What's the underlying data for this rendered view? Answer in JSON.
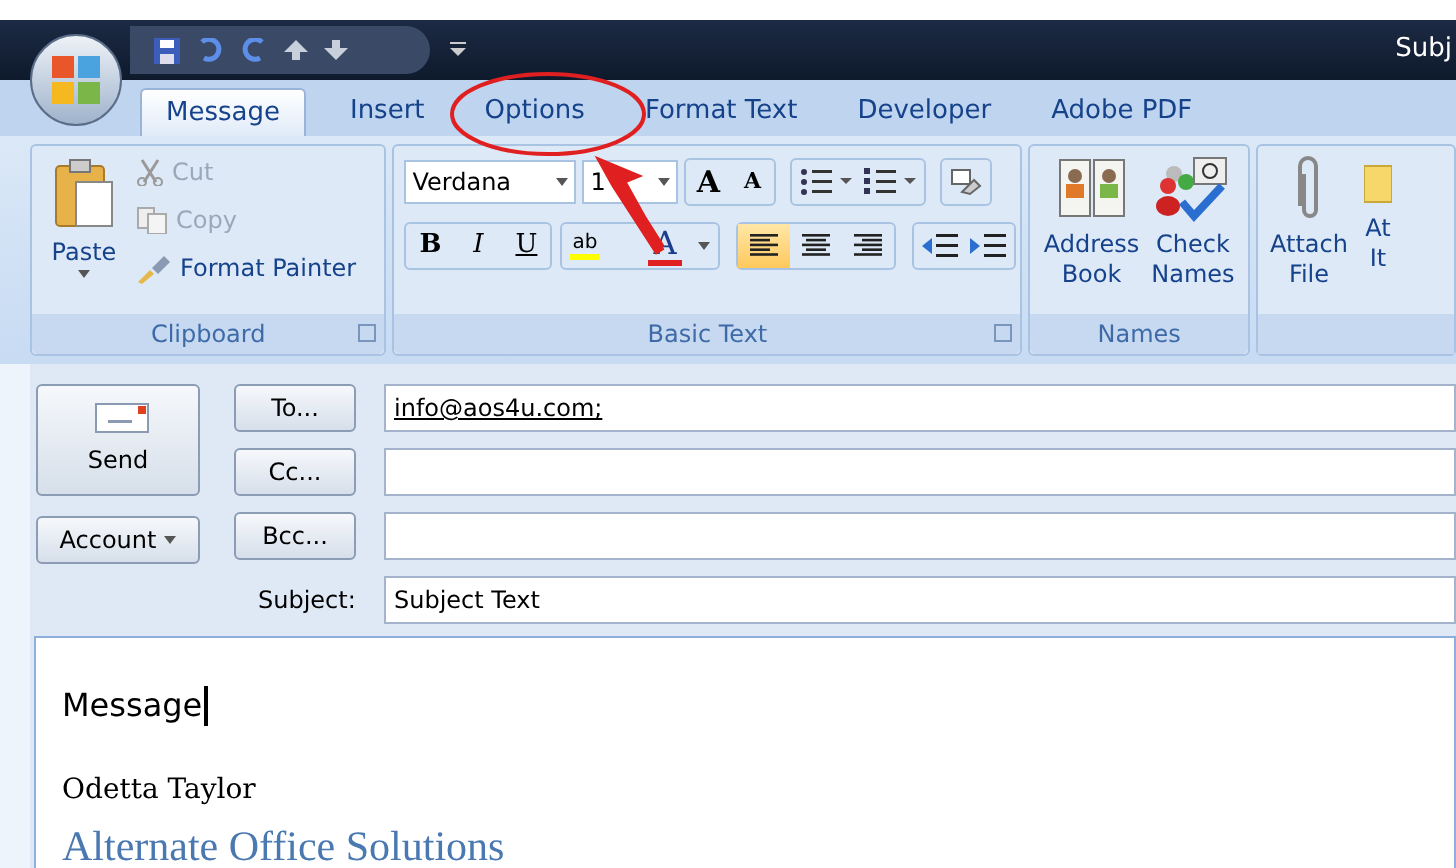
{
  "window": {
    "title": "Subj"
  },
  "tabs": [
    {
      "label": "Message",
      "selected": true
    },
    {
      "label": "Insert",
      "selected": false
    },
    {
      "label": "Options",
      "selected": false
    },
    {
      "label": "Format Text",
      "selected": false
    },
    {
      "label": "Developer",
      "selected": false
    },
    {
      "label": "Adobe PDF",
      "selected": false
    }
  ],
  "clipboard": {
    "label": "Clipboard",
    "paste": "Paste",
    "items": [
      {
        "kind": "cut",
        "label": "Cut",
        "disabled": true
      },
      {
        "kind": "copy",
        "label": "Copy",
        "disabled": true
      },
      {
        "kind": "painter",
        "label": "Format Painter",
        "disabled": false
      }
    ]
  },
  "basic_text": {
    "label": "Basic Text",
    "font": "Verdana",
    "size": "1",
    "grow": "A",
    "shrink": "A",
    "bold": "B",
    "italic": "I",
    "underline": "U",
    "highlight": "ab",
    "font_color": "A",
    "align": [
      {
        "kind": "left",
        "selected": true
      },
      {
        "kind": "center",
        "selected": false
      },
      {
        "kind": "right",
        "selected": false
      }
    ]
  },
  "names": {
    "label": "Names",
    "buttons": [
      {
        "kind": "book",
        "lines": [
          "Address",
          "Book"
        ]
      },
      {
        "kind": "check",
        "lines": [
          "Check",
          "Names"
        ]
      }
    ]
  },
  "include": {
    "buttons": [
      {
        "kind": "clip",
        "lines": [
          "Attach",
          "File"
        ]
      },
      {
        "kind": "item",
        "lines": [
          "At",
          "It"
        ]
      }
    ]
  },
  "compose": {
    "send": "Send",
    "account": "Account",
    "fields": [
      {
        "kind": "button",
        "label": "To...",
        "value": "info@aos4u.com;"
      },
      {
        "kind": "button",
        "label": "Cc..."
      },
      {
        "kind": "button",
        "label": "Bcc..."
      },
      {
        "kind": "label",
        "label": "Subject:",
        "value": "Subject Text"
      }
    ]
  },
  "body": {
    "message": "Message",
    "name": "Odetta Taylor",
    "company": "Alternate Office Solutions"
  }
}
